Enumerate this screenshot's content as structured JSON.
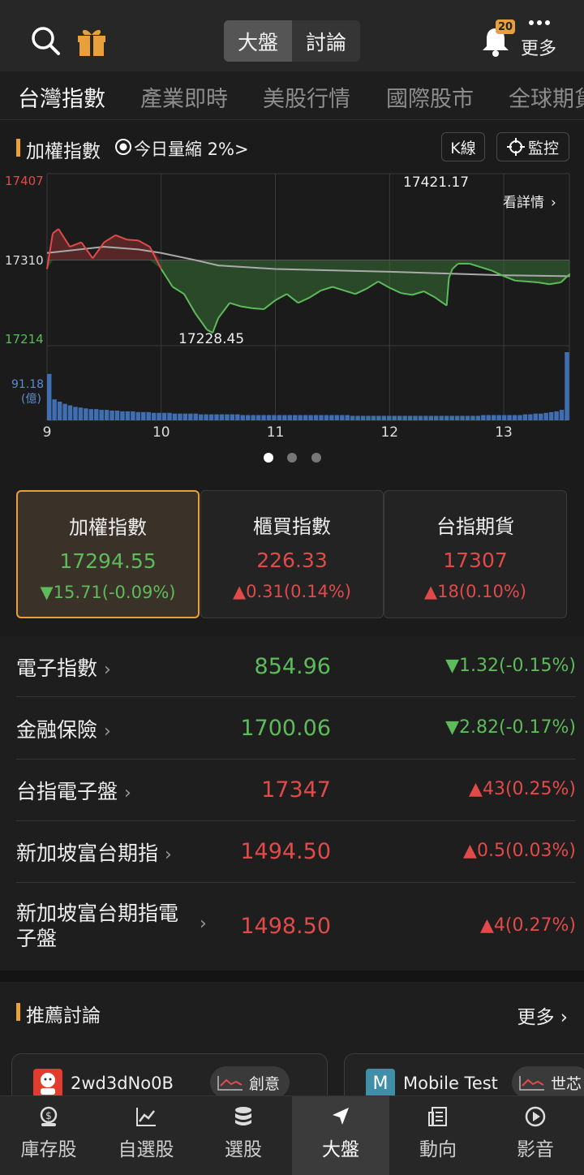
{
  "header": {
    "segments": [
      "大盤",
      "討論"
    ],
    "active_segment": 0,
    "notif_count": "20",
    "more_label": "更多"
  },
  "tabs": [
    "台灣指數",
    "產業即時",
    "美股行情",
    "國際股市",
    "全球期貨"
  ],
  "chart_header": {
    "title": "加權指數",
    "subtitle": "今日量縮 2%>",
    "k_button": "K線",
    "monitor_button": "監控",
    "details_link": "看詳情"
  },
  "chart_data": {
    "type": "line",
    "title": "加權指數",
    "y_max_label": "17407",
    "y_ref_label": "17310",
    "y_min_label": "17214",
    "ylim": [
      17214,
      17407
    ],
    "reference": 17310,
    "high_label": "17421.17",
    "low_label": "17228.45",
    "volume_label": "91.18",
    "volume_unit": "(億)",
    "x_ticks": [
      "9",
      "10",
      "11",
      "12",
      "13"
    ],
    "series": [
      {
        "name": "",
        "x": [
          9.0,
          9.05,
          9.1,
          9.15,
          9.2,
          9.3,
          9.4,
          9.5,
          9.6,
          9.7,
          9.8,
          9.9,
          10.0,
          10.1,
          10.2,
          10.3,
          10.4,
          10.45,
          10.5,
          10.6,
          10.7,
          10.8,
          10.9,
          11.0,
          11.1,
          11.2,
          11.3,
          11.4,
          11.5,
          11.6,
          11.7,
          11.8,
          11.9,
          12.0,
          12.1,
          12.2,
          12.3,
          12.4,
          12.5,
          12.52,
          12.55,
          12.6,
          12.7,
          12.8,
          12.9,
          13.0,
          13.1,
          13.2,
          13.3,
          13.4,
          13.5,
          13.58
        ],
        "values": [
          17300,
          17340,
          17345,
          17335,
          17325,
          17330,
          17312,
          17330,
          17338,
          17333,
          17332,
          17325,
          17300,
          17280,
          17272,
          17250,
          17232,
          17228.45,
          17245,
          17262,
          17258,
          17256,
          17255,
          17265,
          17272,
          17262,
          17268,
          17276,
          17280,
          17276,
          17272,
          17278,
          17286,
          17279,
          17273,
          17271,
          17275,
          17268,
          17259,
          17290,
          17300,
          17306,
          17306,
          17302,
          17298,
          17292,
          17287,
          17286,
          17285,
          17283,
          17285,
          17294.55
        ]
      },
      {
        "name": "",
        "x": [
          9.0,
          9.5,
          9.8,
          10.0,
          10.3,
          10.5,
          11.0,
          12.0,
          13.0,
          13.58
        ],
        "values": [
          17318,
          17325,
          17322,
          17318,
          17310,
          17304,
          17300,
          17297,
          17293,
          17292
        ]
      }
    ],
    "volume": [
      62,
      28,
      25,
      22,
      20,
      18,
      17,
      16,
      15,
      15,
      14,
      14,
      13,
      13,
      12,
      12,
      12,
      11,
      11,
      11,
      10,
      10,
      10,
      10,
      9,
      9,
      9,
      9,
      9,
      8,
      8,
      8,
      8,
      8,
      8,
      8,
      8,
      7,
      7,
      7,
      7,
      7,
      7,
      7,
      7,
      7,
      7,
      7,
      7,
      7,
      7,
      7,
      7,
      7,
      7,
      7,
      7,
      7,
      6,
      6,
      6,
      6,
      6,
      6,
      6,
      6,
      6,
      6,
      6,
      6,
      6,
      6,
      6,
      6,
      6,
      6,
      6,
      6,
      6,
      6,
      6,
      6,
      6,
      7,
      7,
      7,
      7,
      7,
      7,
      7,
      7,
      8,
      8,
      9,
      9,
      10,
      11,
      12,
      14,
      91
    ]
  },
  "pager": {
    "count": 3,
    "active": 0
  },
  "cards": [
    {
      "name": "加權指數",
      "value": "17294.55",
      "change": "▼15.71(-0.09%)",
      "dir": "down"
    },
    {
      "name": "櫃買指數",
      "value": "226.33",
      "change": "▲0.31(0.14%)",
      "dir": "up"
    },
    {
      "name": "台指期貨",
      "value": "17307",
      "change": "▲18(0.10%)",
      "dir": "up"
    }
  ],
  "rows": [
    {
      "name": "電子指數",
      "value": "854.96",
      "change": "▼1.32(-0.15%)",
      "dir": "down"
    },
    {
      "name": "金融保險",
      "value": "1700.06",
      "change": "▼2.82(-0.17%)",
      "dir": "down"
    },
    {
      "name": "台指電子盤",
      "value": "17347",
      "change": "▲43(0.25%)",
      "dir": "up"
    },
    {
      "name": "新加坡富台期指",
      "value": "1494.50",
      "change": "▲0.5(0.03%)",
      "dir": "up"
    },
    {
      "name": "新加坡富台期指電",
      "name2": "子盤",
      "value": "1498.50",
      "change": "▲4(0.27%)",
      "dir": "up"
    }
  ],
  "recommend": {
    "title": "推薦討論",
    "more": "更多",
    "posts": [
      {
        "user": "2wd3dNo0B",
        "tag": "創意"
      },
      {
        "user": "Mobile Test",
        "avatar_letter": "M",
        "tag": "世芯"
      }
    ]
  },
  "bottom_nav": [
    "庫存股",
    "自選股",
    "選股",
    "大盤",
    "動向",
    "影音"
  ],
  "bottom_nav_active": 3,
  "colors": {
    "up": "#e24a4a",
    "down": "#5dbb5a",
    "accent": "#e8a13a"
  }
}
